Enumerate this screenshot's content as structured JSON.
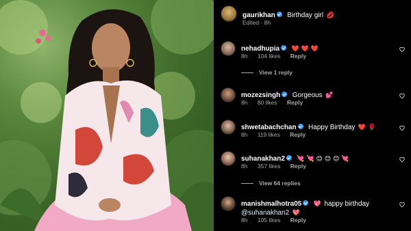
{
  "photo": {
    "subject": "woman in pink-and-white floral blouse and pink trousers seated among green foliage"
  },
  "post": {
    "username": "gaurikhan",
    "caption": "Birthday girl",
    "caption_emoji": "💋",
    "edited": "Edited · 8h"
  },
  "comments": [
    {
      "username": "nehadhupia",
      "text": "",
      "emoji": "❤️ ❤️ ❤️",
      "time": "8h",
      "likes": "104 likes",
      "reply": "Reply"
    },
    {
      "username": "mozezsingh",
      "text": "Gorgeous",
      "emoji": "💕",
      "time": "8h",
      "likes": "80 likes",
      "reply": "Reply"
    },
    {
      "username": "shwetabachchan",
      "text": "Happy Birthday",
      "emoji": "❤️ 🌹",
      "time": "8h",
      "likes": "119 likes",
      "reply": "Reply"
    },
    {
      "username": "suhanakhan2",
      "text": "",
      "emoji": "💘 💘 😊 😊 😊 💘",
      "time": "8h",
      "likes": "357 likes",
      "reply": "Reply"
    },
    {
      "username": "manishmalhotra05",
      "text": "happy birthday",
      "emoji": "💖",
      "mention": "@suhanakhan2",
      "mention_emoji": "💖",
      "time": "8h",
      "likes": "105 likes",
      "reply": "Reply"
    }
  ],
  "view_replies": {
    "first": "View 1 reply",
    "second": "View 64 replies"
  },
  "colors": {
    "background": "#000000",
    "verified": "#3897f0",
    "meta": "#a8a8a8"
  }
}
